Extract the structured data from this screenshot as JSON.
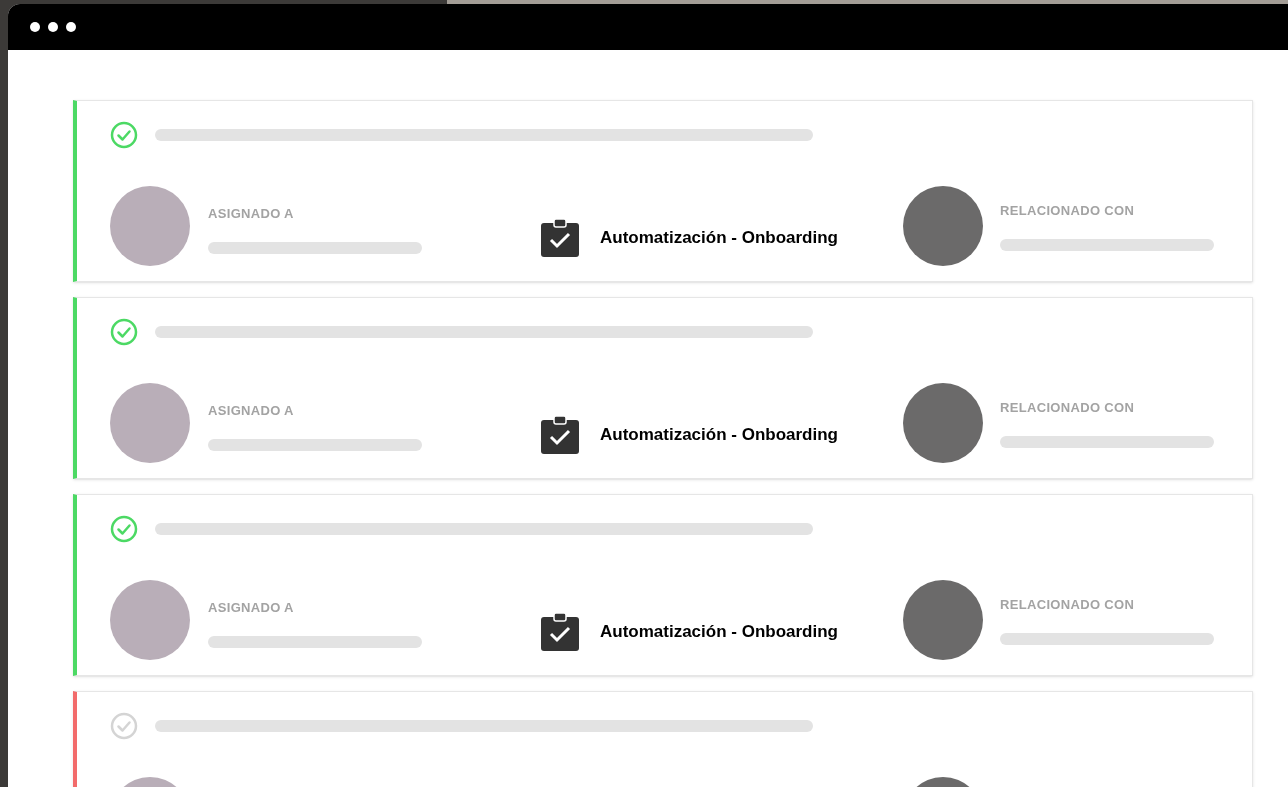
{
  "window": {
    "controls": [
      {
        "kind": "dot"
      },
      {
        "kind": "dot"
      },
      {
        "kind": "dot"
      }
    ]
  },
  "tasks": [
    {
      "completed": true,
      "assigned_label": "ASIGNADO A",
      "task": "Automatización - Onboarding",
      "related_label": "RELACIONADO CON"
    },
    {
      "completed": true,
      "assigned_label": "ASIGNADO A",
      "task": "Automatización - Onboarding",
      "related_label": "RELACIONADO CON"
    },
    {
      "completed": true,
      "assigned_label": "ASIGNADO A",
      "task": "Automatización - Onboarding",
      "related_label": "RELACIONADO CON"
    },
    {
      "completed": false
    }
  ]
}
